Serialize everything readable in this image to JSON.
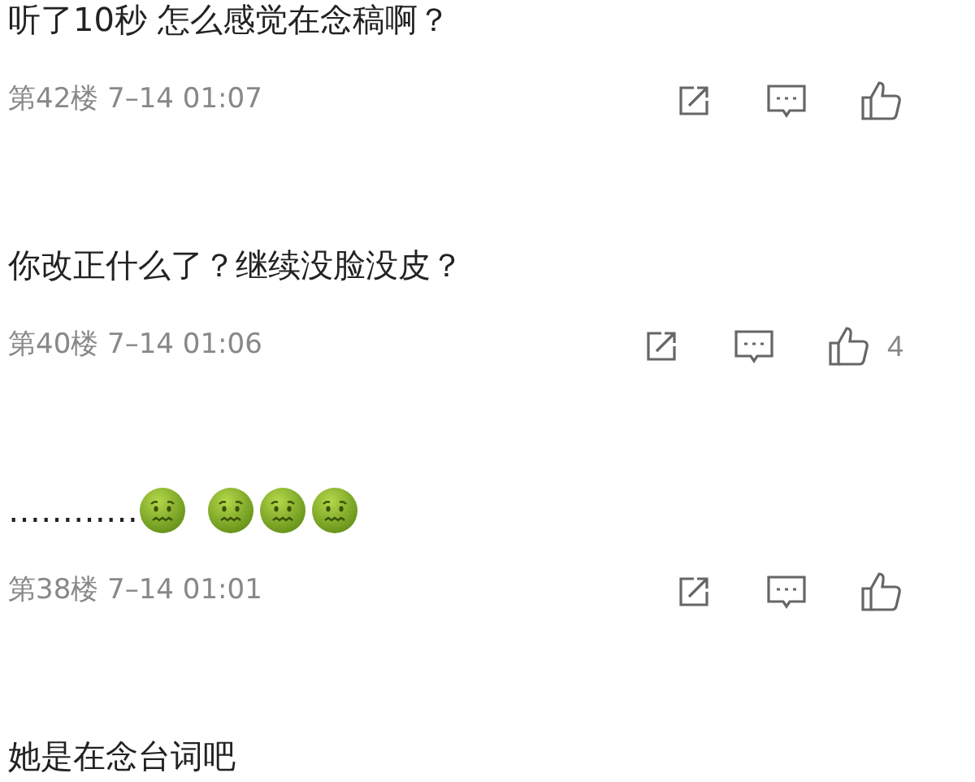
{
  "comments": [
    {
      "content": [
        {
          "kind": "text",
          "text": "听了10秒 怎么感觉在念稿啊？"
        }
      ],
      "floor": "第42楼",
      "time": "7–14 01:07"
    },
    {
      "content": [
        {
          "kind": "text",
          "text": "你改正什么了？继续没脸没皮？"
        }
      ],
      "floor": "第40楼",
      "time": "7–14 01:06",
      "likes": "4"
    },
    {
      "content": [
        {
          "kind": "text",
          "text": "…………"
        },
        {
          "kind": "emoji"
        },
        {
          "kind": "emoji"
        },
        {
          "kind": "emoji"
        },
        {
          "kind": "emoji"
        }
      ],
      "floor": "第38楼",
      "time": "7–14 01:01"
    },
    {
      "content": [
        {
          "kind": "text",
          "text": "她是在念台词吧"
        }
      ]
    }
  ]
}
